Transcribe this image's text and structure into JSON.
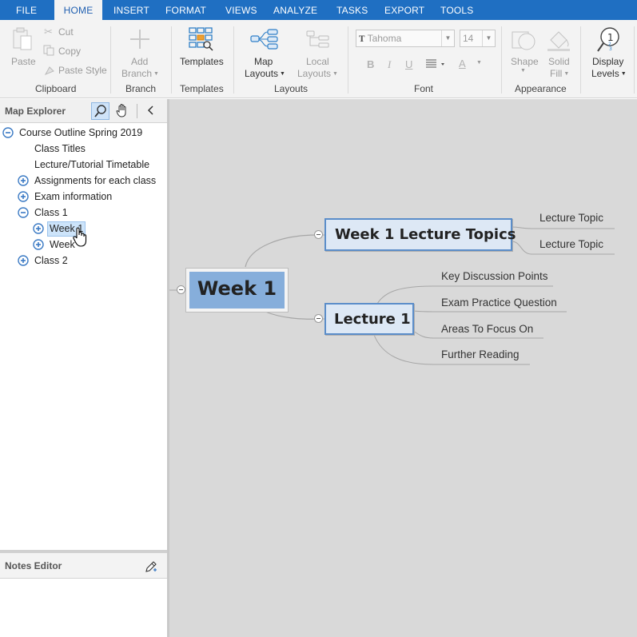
{
  "tabs": [
    {
      "label": "FILE",
      "active": false
    },
    {
      "label": "HOME",
      "active": true
    },
    {
      "label": "INSERT",
      "active": false
    },
    {
      "label": "FORMAT",
      "active": false
    },
    {
      "label": "VIEWS",
      "active": false
    },
    {
      "label": "ANALYZE",
      "active": false
    },
    {
      "label": "TASKS",
      "active": false
    },
    {
      "label": "EXPORT",
      "active": false
    },
    {
      "label": "TOOLS",
      "active": false
    }
  ],
  "ribbon": {
    "clipboard": {
      "paste": "Paste",
      "cut": "Cut",
      "copy": "Copy",
      "paste_style": "Paste Style",
      "group": "Clipboard"
    },
    "branch": {
      "add1": "Add",
      "add2": "Branch",
      "group": "Branch"
    },
    "templates": {
      "label": "Templates",
      "group": "Templates"
    },
    "layouts": {
      "map1": "Map",
      "map2": "Layouts",
      "local1": "Local",
      "local2": "Layouts",
      "group": "Layouts"
    },
    "font": {
      "family": "Tahoma",
      "size": "14",
      "group": "Font"
    },
    "appearance": {
      "shape": "Shape",
      "solid1": "Solid",
      "solid2": "Fill",
      "group": "Appearance"
    },
    "display": {
      "l1": "Display",
      "l2": "Levels"
    }
  },
  "explorer": {
    "title": "Map Explorer",
    "items": [
      {
        "label": "Course Outline Spring 2019"
      },
      {
        "label": "Class Titles"
      },
      {
        "label": "Lecture/Tutorial Timetable"
      },
      {
        "label": "Assignments for each class"
      },
      {
        "label": "Exam information"
      },
      {
        "label": "Class 1"
      },
      {
        "label": "Week 1"
      },
      {
        "label": "Week"
      },
      {
        "label": "Class 2"
      }
    ]
  },
  "notes": {
    "title": "Notes Editor"
  },
  "map": {
    "central": "Week 1",
    "topic1": "Week 1 Lecture Topics",
    "topic1_subs": [
      "Lecture Topic",
      "Lecture Topic"
    ],
    "topic2": "Lecture 1",
    "topic2_subs": [
      "Key Discussion Points",
      "Exam Practice Question",
      "Areas To Focus On",
      "Further Reading"
    ]
  },
  "colors": {
    "accent": "#1f6fc2",
    "central_fill": "#86aedb",
    "topic_border": "#5b8dc9",
    "topic_fill": "#dde8f5",
    "canvas": "#d9d9d9"
  }
}
